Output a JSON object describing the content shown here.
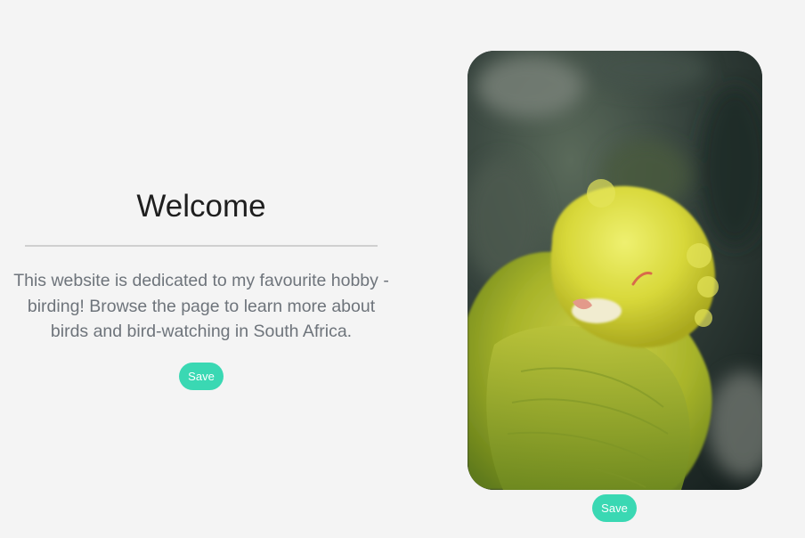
{
  "intro": {
    "title": "Welcome",
    "text": "This website is dedicated to my favourite hobby - birding! Browse the page to learn more about birds and bird-watching in South Africa.",
    "save_label": "Save"
  },
  "photo": {
    "icon": "bird-photo",
    "save_label": "Save"
  },
  "colors": {
    "background": "#f4f4f4",
    "accent": "#3ad8b3",
    "title": "#1e1e1e",
    "body_text": "#6e747b"
  }
}
